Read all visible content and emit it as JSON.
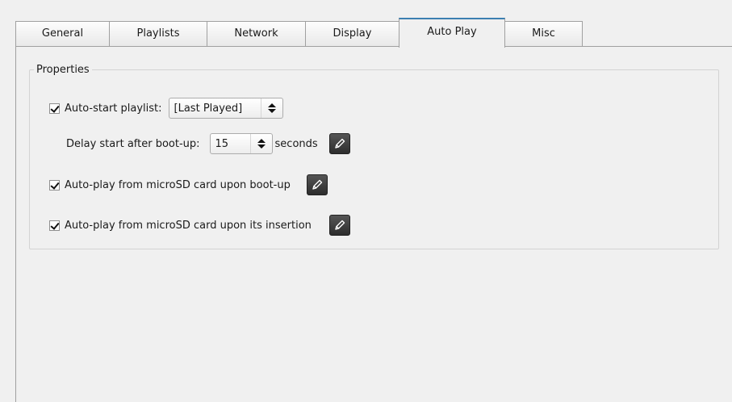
{
  "tabs": [
    {
      "label": "General",
      "active": false
    },
    {
      "label": "Playlists",
      "active": false
    },
    {
      "label": "Network",
      "active": false
    },
    {
      "label": "Display",
      "active": false
    },
    {
      "label": "Auto Play",
      "active": true
    },
    {
      "label": "Misc",
      "active": false
    }
  ],
  "properties": {
    "legend": "Properties",
    "autostart": {
      "checked": true,
      "label": "Auto-start playlist:",
      "selected": "[Last Played]"
    },
    "delay": {
      "label": "Delay start after boot-up:",
      "value": "15",
      "unit": "seconds"
    },
    "autoplay_boot": {
      "checked": true,
      "label": "Auto-play from microSD card upon boot-up"
    },
    "autoplay_insert": {
      "checked": true,
      "label": "Auto-play from microSD card upon its insertion"
    }
  },
  "icons": {
    "edit": "pencil-icon"
  },
  "colors": {
    "active_tab_accent": "#3c7fb1",
    "edit_button_bg": "#3a3a3a"
  }
}
